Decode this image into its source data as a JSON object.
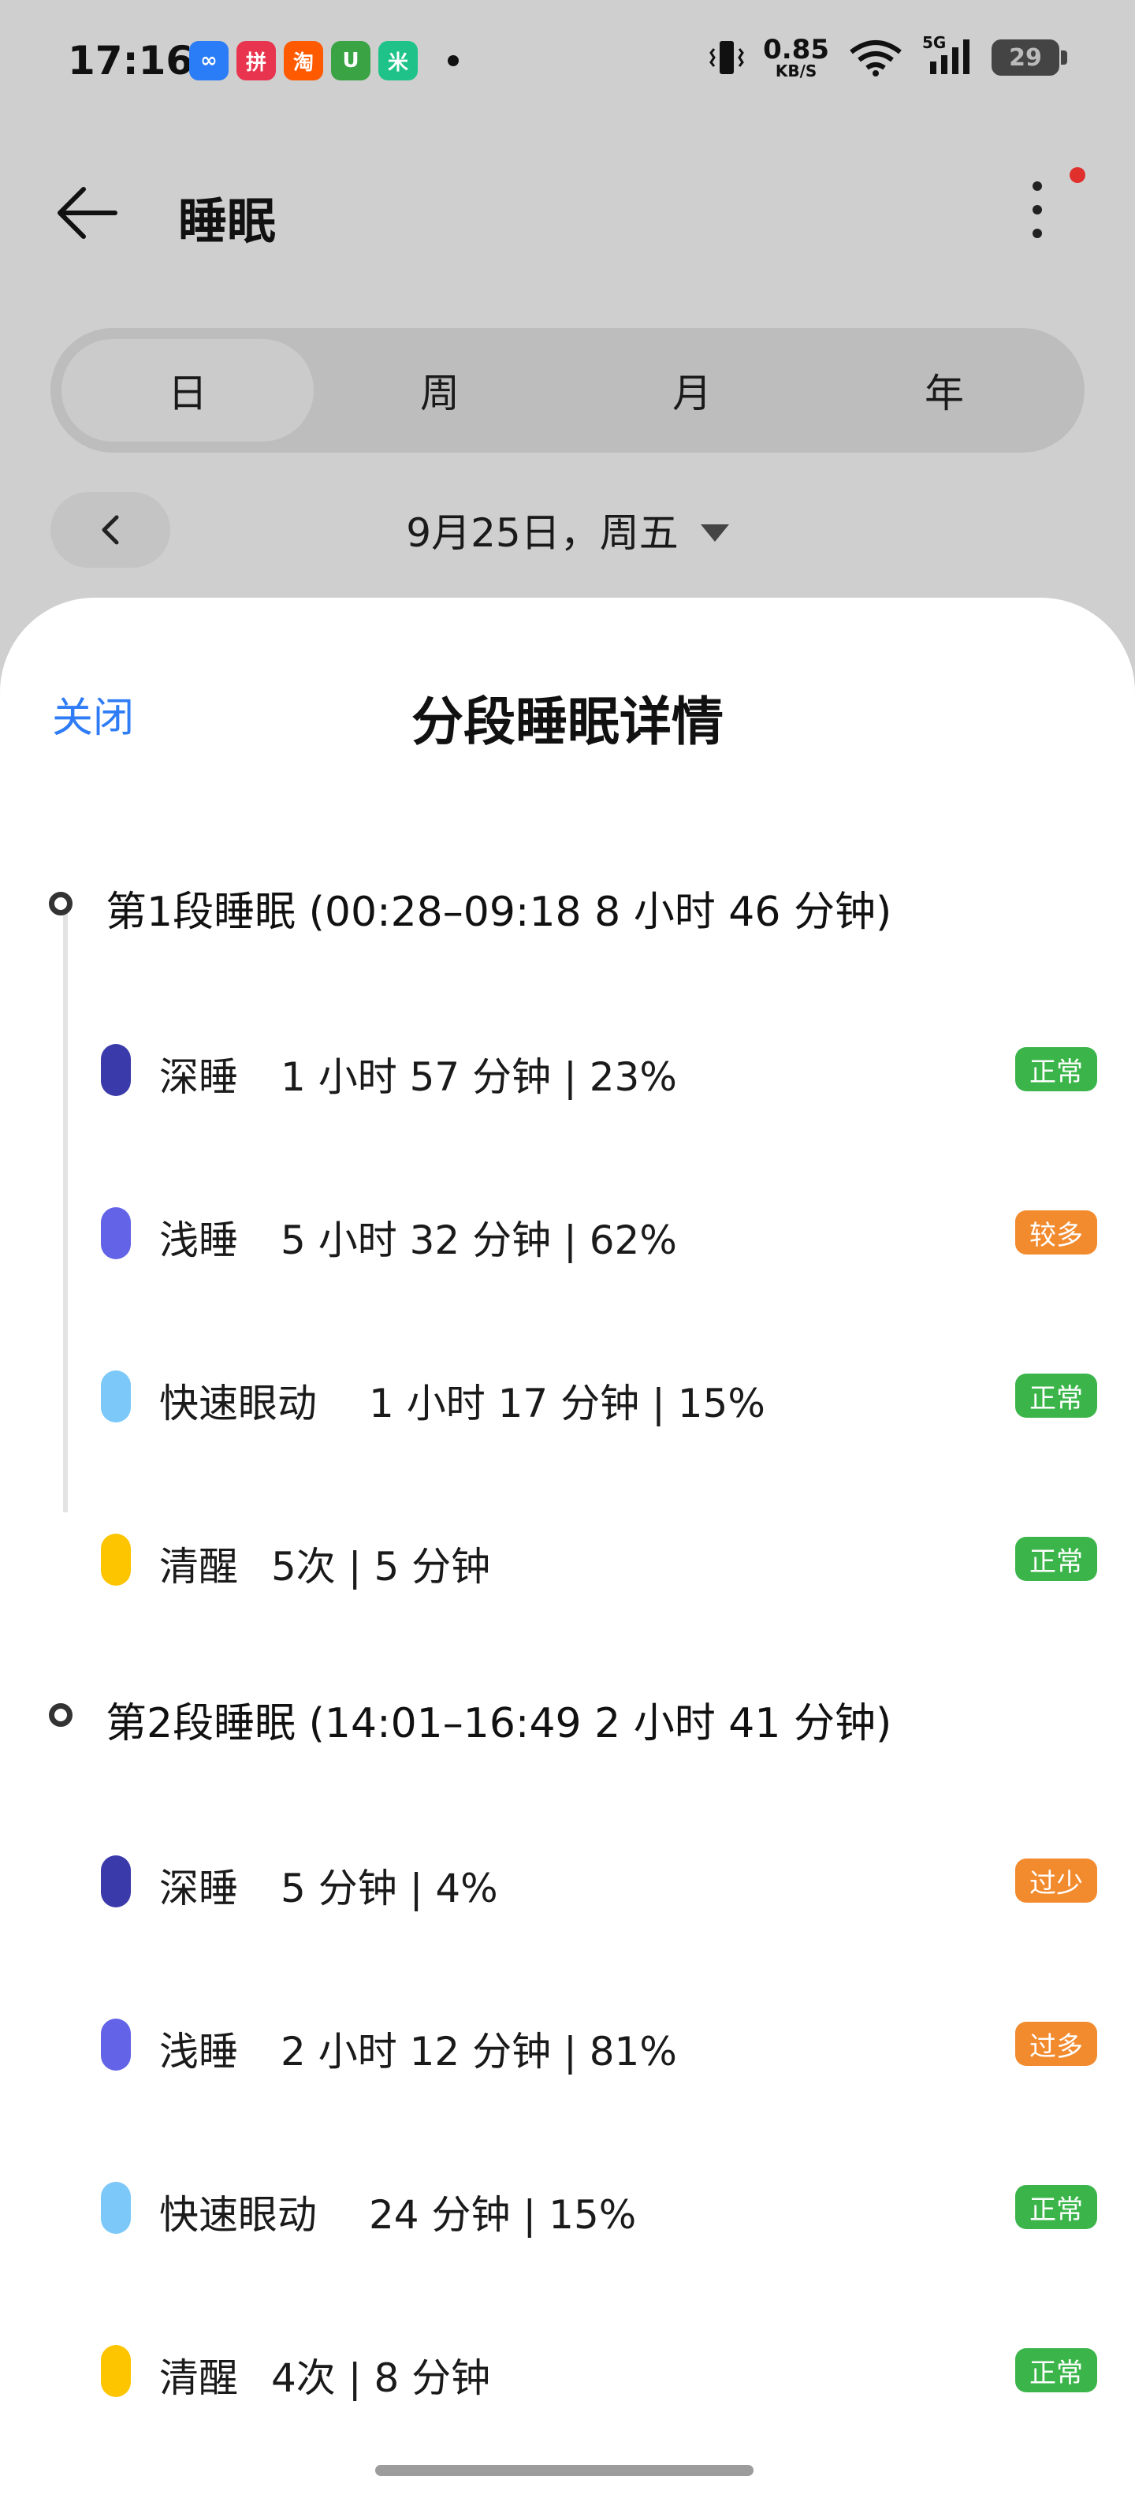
{
  "status_bar": {
    "time": "17:16",
    "apps": [
      {
        "icon": "baidu-netdisk-icon",
        "glyph": "∞",
        "color": "#2a7cf7"
      },
      {
        "icon": "pinduoduo-icon",
        "glyph": "拼",
        "color": "#e8344e"
      },
      {
        "icon": "taobao-icon",
        "glyph": "淘",
        "color": "#ff5a00"
      },
      {
        "icon": "meituan-icon",
        "glyph": "U",
        "color": "#3aa344"
      },
      {
        "icon": "mi-home-icon",
        "glyph": "米",
        "color": "#1fc38a"
      }
    ],
    "net_speed": "0.85",
    "net_unit": "KB/S",
    "network": "5G",
    "battery": "29"
  },
  "header": {
    "title": "睡眠"
  },
  "tabs": [
    {
      "label": "日",
      "active": true
    },
    {
      "label": "周",
      "active": false
    },
    {
      "label": "月",
      "active": false
    },
    {
      "label": "年",
      "active": false
    }
  ],
  "date_selector": {
    "date": "9月25日，周五"
  },
  "sheet": {
    "close_label": "关闭",
    "title": "分段睡眠详情",
    "segments": [
      {
        "title": "第1段睡眠 (00:28–09:18  8 小时 46 分钟)",
        "rows": [
          {
            "name": "深睡",
            "value": "1 小时 57 分钟 | 23%",
            "badge": "正常",
            "color": "#3a3aaa",
            "badge_color": "#3bb54a"
          },
          {
            "name": "浅睡",
            "value": "5 小时 32 分钟 | 62%",
            "badge": "较多",
            "color": "#6363e8",
            "badge_color": "#f28a2e"
          },
          {
            "name": "快速眼动",
            "value": "1 小时 17 分钟 | 15%",
            "badge": "正常",
            "color": "#7cc8f8",
            "badge_color": "#3bb54a"
          },
          {
            "name": "清醒",
            "value": "5次 |  5 分钟",
            "badge": "正常",
            "color": "#fdc400",
            "badge_color": "#3bb54a"
          }
        ]
      },
      {
        "title": "第2段睡眠 (14:01–16:49  2 小时 41 分钟)",
        "rows": [
          {
            "name": "深睡",
            "value": "5 分钟 | 4%",
            "badge": "过少",
            "color": "#3a3aaa",
            "badge_color": "#f28a2e"
          },
          {
            "name": "浅睡",
            "value": "2 小时 12 分钟 | 81%",
            "badge": "过多",
            "color": "#6363e8",
            "badge_color": "#f28a2e"
          },
          {
            "name": "快速眼动",
            "value": "24 分钟 | 15%",
            "badge": "正常",
            "color": "#7cc8f8",
            "badge_color": "#3bb54a"
          },
          {
            "name": "清醒",
            "value": "4次 |  8 分钟",
            "badge": "正常",
            "color": "#fdc400",
            "badge_color": "#3bb54a"
          }
        ]
      }
    ]
  }
}
